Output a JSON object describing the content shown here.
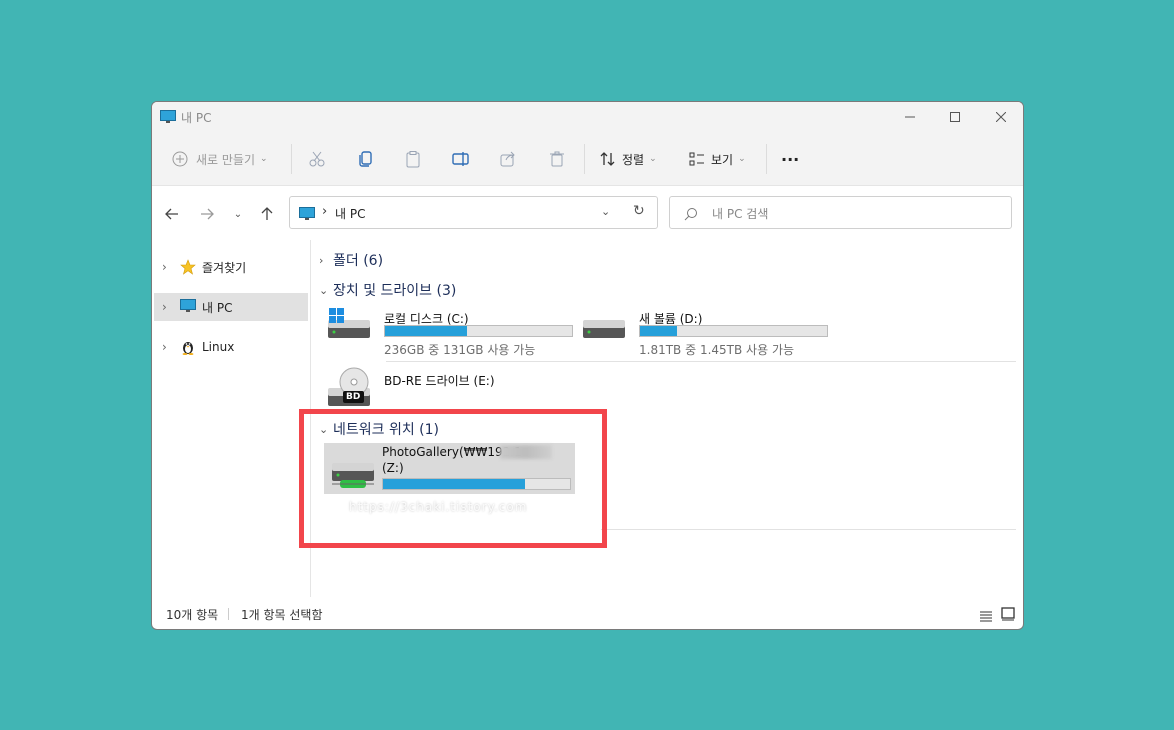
{
  "window": {
    "title": "내 PC"
  },
  "toolbar": {
    "new_label": "새로 만들기",
    "sort_label": "정렬",
    "view_label": "보기",
    "more_label": "···"
  },
  "address": {
    "path": "내 PC",
    "search_placeholder": "내 PC 검색"
  },
  "sidebar": {
    "items": [
      {
        "label": "즐겨찾기",
        "icon": "star-icon"
      },
      {
        "label": "내 PC",
        "icon": "monitor-icon"
      },
      {
        "label": "Linux",
        "icon": "linux-penguin-icon"
      }
    ]
  },
  "content": {
    "groups": [
      {
        "label": "폴더 (6)"
      },
      {
        "label": "장치 및 드라이브 (3)"
      },
      {
        "label": "네트워크 위치 (1)"
      }
    ],
    "drives": [
      {
        "name": "로컬 디스크 (C:)",
        "free": "236GB 중 131GB 사용 가능",
        "used_fraction": 0.44
      },
      {
        "name": "새 볼륨 (D:)",
        "free": "1.81TB 중 1.45TB 사용 가능",
        "used_fraction": 0.2
      },
      {
        "name": "BD-RE 드라이브 (E:)",
        "badge": "BD"
      }
    ],
    "network": [
      {
        "name_line1": "PhotoGallery(₩₩192.1",
        "name_line2": "(Z:)",
        "used_fraction": 0.76
      }
    ]
  },
  "watermark": "https://3chaki.tistory.com",
  "status": {
    "count": "10개 항목",
    "selected": "1개 항목 선택함"
  },
  "colors": {
    "accent": "#26a0da",
    "highlight": "#f2454b",
    "background": "#41b5b4"
  }
}
